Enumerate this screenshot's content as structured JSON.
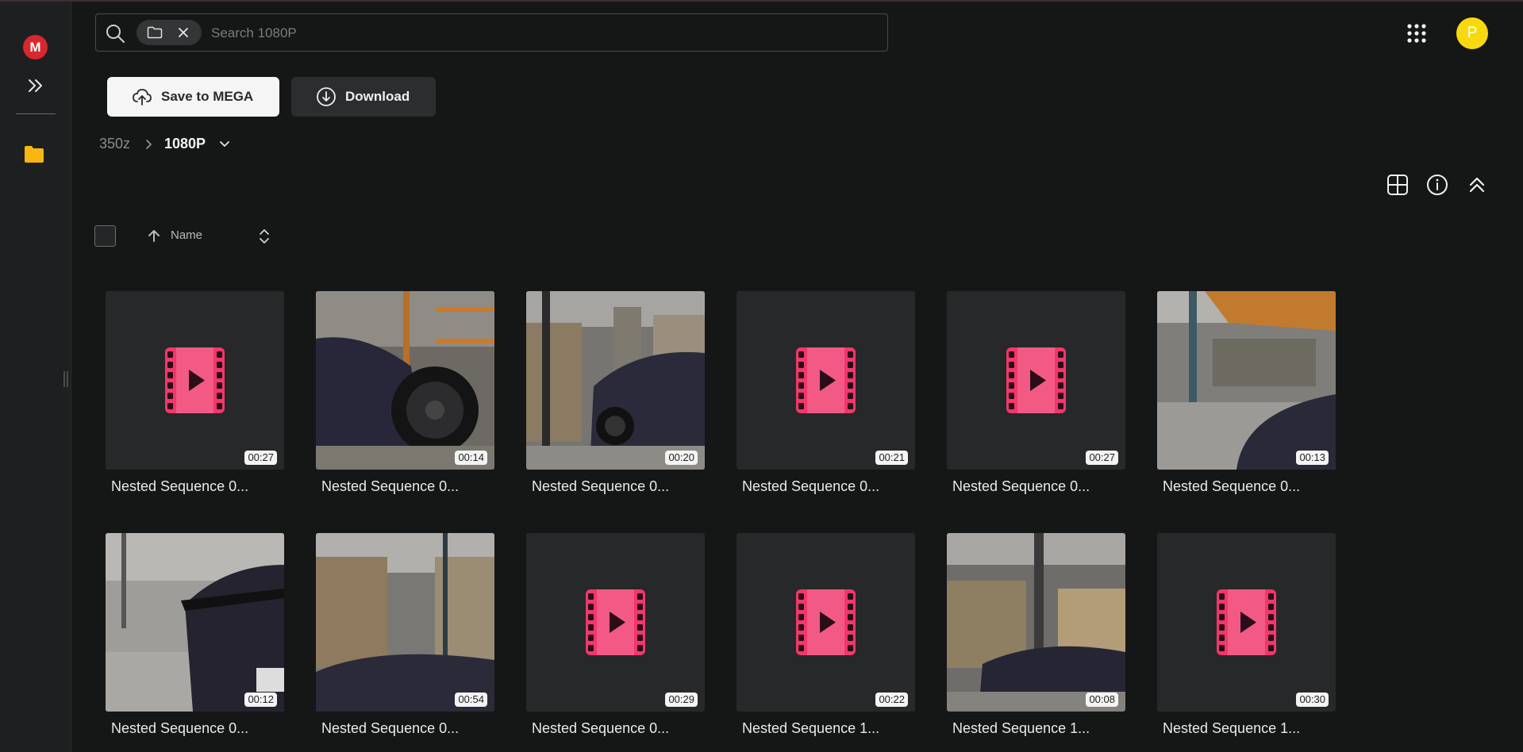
{
  "sidebar": {
    "logo_letter": "M",
    "folder_color": "#f8b613"
  },
  "search": {
    "placeholder": "Search 1080P"
  },
  "header": {
    "avatar_initial": "P",
    "avatar_color": "#f8d90f"
  },
  "toolbar": {
    "save_label": "Save to MEGA",
    "download_label": "Download"
  },
  "breadcrumb": {
    "root": "350z",
    "current": "1080P"
  },
  "sort": {
    "label": "Name",
    "direction": "ascending"
  },
  "colors": {
    "accent_red": "#d9272e",
    "video_icon": "#f1376b",
    "background": "#151616"
  },
  "files": [
    {
      "name": "Nested Sequence 0...",
      "duration": "00:27",
      "thumbnail": "video-placeholder"
    },
    {
      "name": "Nested Sequence 0...",
      "duration": "00:14",
      "thumbnail": "car-wheel-warehouse"
    },
    {
      "name": "Nested Sequence 0...",
      "duration": "00:20",
      "thumbnail": "car-front-aisle"
    },
    {
      "name": "Nested Sequence 0...",
      "duration": "00:21",
      "thumbnail": "video-placeholder"
    },
    {
      "name": "Nested Sequence 0...",
      "duration": "00:27",
      "thumbnail": "video-placeholder"
    },
    {
      "name": "Nested Sequence 0...",
      "duration": "00:13",
      "thumbnail": "car-roof-shelves"
    },
    {
      "name": "Nested Sequence 0...",
      "duration": "00:12",
      "thumbnail": "car-rear-spoiler"
    },
    {
      "name": "Nested Sequence 0...",
      "duration": "00:54",
      "thumbnail": "car-roof-aisle"
    },
    {
      "name": "Nested Sequence 0...",
      "duration": "00:29",
      "thumbnail": "video-placeholder"
    },
    {
      "name": "Nested Sequence 1...",
      "duration": "00:22",
      "thumbnail": "video-placeholder"
    },
    {
      "name": "Nested Sequence 1...",
      "duration": "00:08",
      "thumbnail": "car-side-boxes"
    },
    {
      "name": "Nested Sequence 1...",
      "duration": "00:30",
      "thumbnail": "video-placeholder"
    }
  ]
}
